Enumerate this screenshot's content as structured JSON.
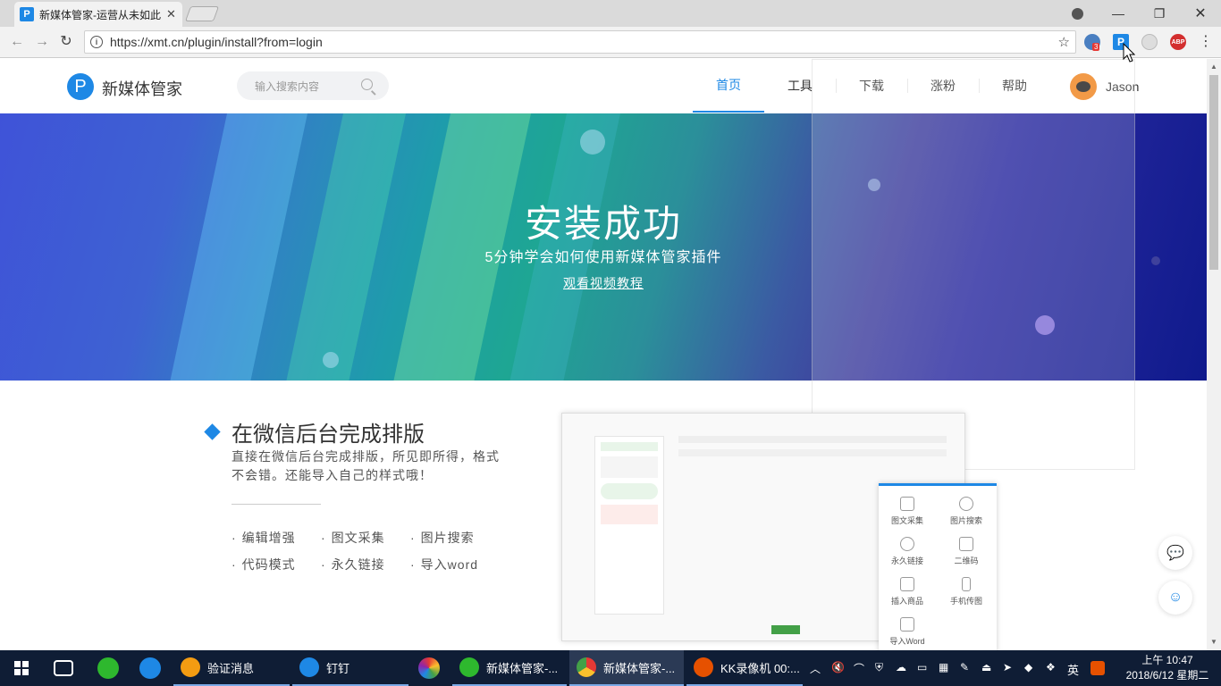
{
  "browser": {
    "tab_title": "新媒体管家-运营从未如此",
    "tab_favicon": "P",
    "tab_close": "✕",
    "url": "https://xmt.cn/plugin/install?from=login",
    "ext_badge": "3",
    "ext_abp": "ABP",
    "win_min": "—",
    "win_restore": "❐",
    "win_close": "✕"
  },
  "site": {
    "logo_letter": "P",
    "brand": "新媒体管家",
    "search_placeholder": "输入搜索内容",
    "nav": [
      {
        "label": "首页"
      },
      {
        "label": "工具"
      },
      {
        "label": "下载"
      },
      {
        "label": "涨粉"
      },
      {
        "label": "帮助"
      }
    ],
    "username": "Jason"
  },
  "hero": {
    "title": "安装成功",
    "subtitle": "5分钟学会如何使用新媒体管家插件",
    "link": "观看视频教程"
  },
  "feature": {
    "title": "在微信后台完成排版",
    "description": "直接在微信后台完成排版，所见即所得，格式不会错。还能导入自己的样式哦！",
    "items": [
      "编辑增强",
      "图文采集",
      "图片搜索",
      "代码模式",
      "永久链接",
      "导入word"
    ]
  },
  "popup_menu": {
    "items": [
      "图文采集",
      "图片搜索",
      "永久链接",
      "二维码",
      "插入商品",
      "手机传图",
      "导入Word"
    ]
  },
  "taskbar": {
    "items": [
      {
        "label": "验证消息"
      },
      {
        "label": "钉钉"
      },
      {
        "label": "新媒体管家-..."
      },
      {
        "label": "新媒体管家-..."
      },
      {
        "label": "KK录像机 00:..."
      }
    ],
    "ime": "英",
    "time": "上午 10:47",
    "date": "2018/6/12 星期二"
  },
  "colors": {
    "accent": "#1e88e5",
    "taskbar": "#0f1d35"
  }
}
